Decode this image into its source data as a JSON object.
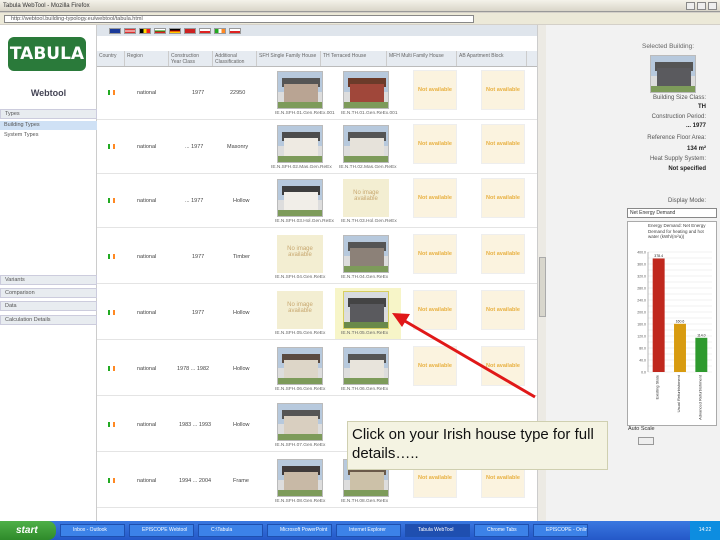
{
  "window": {
    "title": "Tabula WebTool - Mozilla Firefox",
    "url": "http://webtool.building-typology.eu/webtool/tabula.html"
  },
  "left": {
    "logo": "TABULA",
    "subtitle": "Webtool",
    "types_header": "Types",
    "types_items": [
      "Building Types",
      "System Types"
    ],
    "bottom_headers": [
      "Variants",
      "Comparison",
      "Data",
      "Calculation Details"
    ]
  },
  "columns": [
    "Country",
    "Region",
    "Construction Year Class",
    "Additional Classification",
    "SFH Single Family House",
    "TH Terraced House",
    "MFH Multi Family House",
    "AB Apartment Block"
  ],
  "not_available": "Not available",
  "no_image": "No image available",
  "rows": [
    {
      "region": "national",
      "year": "1977",
      "addl": "22950",
      "cap1": "IE.N.SFH.01.Gen.ReEx.001",
      "cap2": "IE.N.TH.01.Gen.ReEx.001"
    },
    {
      "region": "national",
      "year": "... 1977",
      "addl": "Masonry",
      "cap1": "IE.N.SFH.02.Mas.Gen.ReEx",
      "cap2": "IE.N.TH.02.Mas.Gen.ReEx"
    },
    {
      "region": "national",
      "year": "... 1977",
      "addl": "Hollow",
      "cap1": "IE.N.SFH.03.Hol.Gen.ReEx",
      "cap2": "IE.N.TH.03.Hol.Gen.ReEx"
    },
    {
      "region": "national",
      "year": "1977",
      "addl": "Timber",
      "cap1": "IE.N.SFH.04.Gen.ReEx",
      "cap2": "IE.N.TH.04.Gen.ReEx"
    },
    {
      "region": "national",
      "year": "1977",
      "addl": "Hollow",
      "cap1": "IE.N.SFH.05.Gen.ReEx",
      "cap2": "IE.N.TH.05.Gen.ReEx"
    },
    {
      "region": "national",
      "year": "1978 ... 1982",
      "addl": "Hollow",
      "cap1": "IE.N.SFH.06.Gen.ReEx",
      "cap2": "IE.N.TH.06.Gen.ReEx"
    },
    {
      "region": "national",
      "year": "1983 ... 1993",
      "addl": "Hollow",
      "cap1": "IE.N.SFH.07.Gen.ReEx",
      "cap2": "IE.N.TH.07.Gen.ReEx"
    },
    {
      "region": "national",
      "year": "1994 ... 2004",
      "addl": "Frame",
      "cap1": "IE.N.SFH.08.Gen.ReEx",
      "cap2": "IE.N.TH.08.Gen.ReEx"
    }
  ],
  "right": {
    "selected_title": "Selected Building:",
    "size_class_label": "Building Size Class:",
    "size_class_value": "TH",
    "period_label": "Construction Period:",
    "period_value": "... 1977",
    "area_label": "Reference Floor Area:",
    "area_value": "134 m²",
    "heat_label": "Heat Supply System:",
    "heat_value": "Not specified",
    "display_label": "Display Mode:",
    "display_value": "Net Energy Demand",
    "chart_title": "Energy Demand: Net Energy Demand for heating and hot water (kWh/(m²a))",
    "auto_label": "Auto Scale"
  },
  "chart_data": {
    "type": "bar",
    "categories": [
      "Existing State",
      "Usual Refurbishment",
      "Advanced Refurbishment"
    ],
    "values": [
      378.4,
      160.6,
      114.0
    ],
    "ylim": [
      0,
      400
    ],
    "colors": [
      "#c0281e",
      "#d89b10",
      "#2e9a2e"
    ]
  },
  "callout": "Click on your Irish house type for full details…..",
  "taskbar": {
    "start": "start",
    "tasks": [
      "Inbox - Outlook",
      "EPISCOPE Webtool",
      "C:\\Tabula",
      "Microsoft PowerPoint",
      "Internet Explorer",
      "Tabula WebTool",
      "Chrome Tabs",
      "EPISCOPE - Online"
    ],
    "clock": "14:22"
  }
}
